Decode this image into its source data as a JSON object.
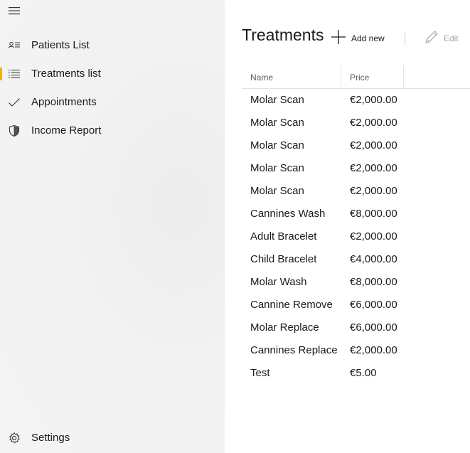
{
  "sidebar": {
    "items": [
      {
        "label": "Patients List",
        "icon": "contact-list-icon",
        "active": false
      },
      {
        "label": "Treatments list",
        "icon": "bulleted-list-icon",
        "active": true
      },
      {
        "label": "Appointments",
        "icon": "checkmark-icon",
        "active": false
      },
      {
        "label": "Income Report",
        "icon": "shield-icon",
        "active": false
      }
    ],
    "settings_label": "Settings",
    "accent_color": "#f0b400"
  },
  "main": {
    "title": "Treatments",
    "add_label": "Add new",
    "edit_label": "Edit",
    "columns": {
      "name": "Name",
      "price": "Price"
    },
    "rows": [
      {
        "name": "Molar Scan",
        "price": "€2,000.00"
      },
      {
        "name": "Molar Scan",
        "price": "€2,000.00"
      },
      {
        "name": "Molar Scan",
        "price": "€2,000.00"
      },
      {
        "name": "Molar Scan",
        "price": "€2,000.00"
      },
      {
        "name": "Molar Scan",
        "price": "€2,000.00"
      },
      {
        "name": "Cannines Wash",
        "price": "€8,000.00"
      },
      {
        "name": "Adult Bracelet",
        "price": "€2,000.00"
      },
      {
        "name": "Child Bracelet",
        "price": "€4,000.00"
      },
      {
        "name": "Molar Wash",
        "price": "€8,000.00"
      },
      {
        "name": "Cannine Remove",
        "price": "€6,000.00"
      },
      {
        "name": "Molar Replace",
        "price": "€6,000.00"
      },
      {
        "name": "Cannines Replace",
        "price": "€2,000.00"
      },
      {
        "name": "Test",
        "price": "€5.00"
      }
    ]
  }
}
